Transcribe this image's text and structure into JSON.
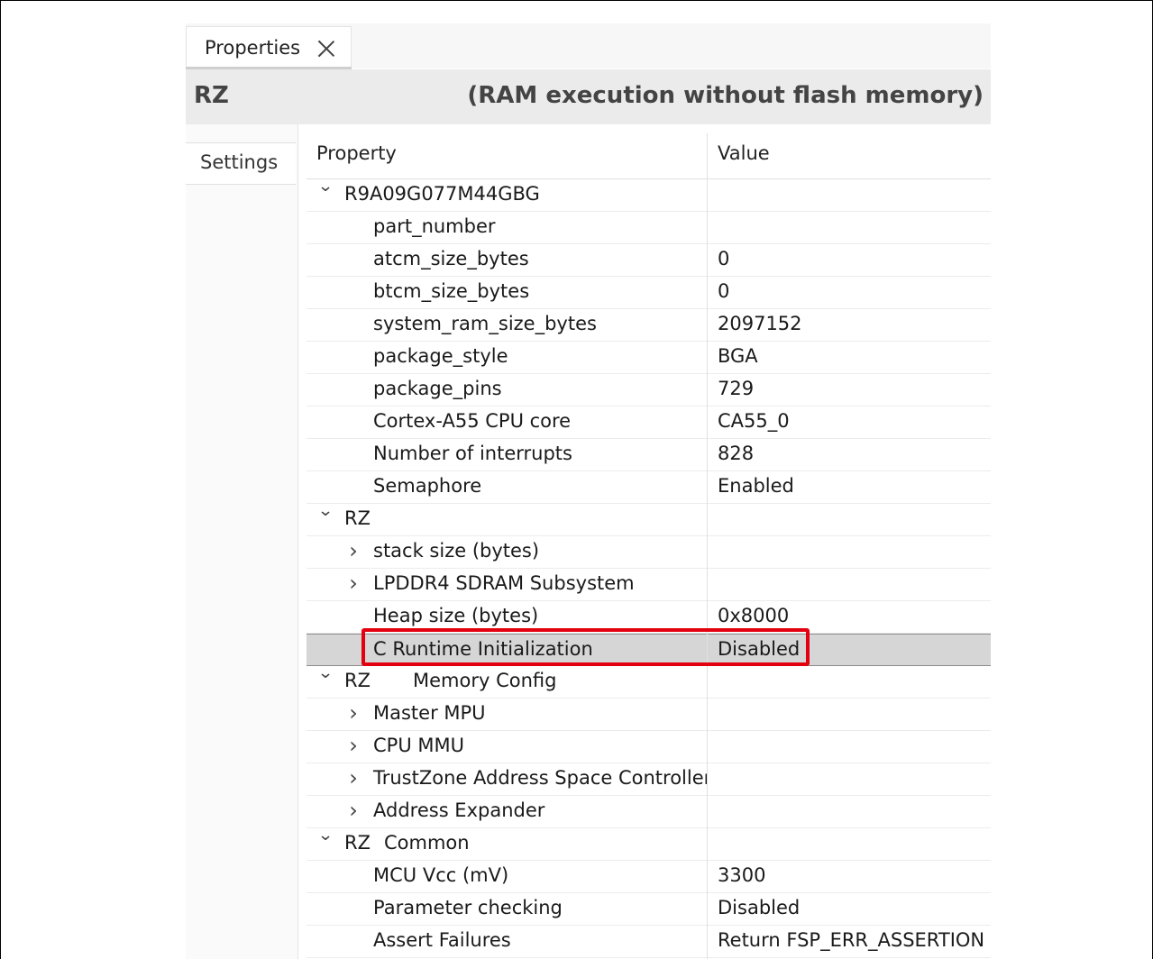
{
  "tab": {
    "label": "Properties",
    "close_icon": "close-icon"
  },
  "header": {
    "left": "RZ",
    "right": "(RAM execution without flash memory)"
  },
  "sidebar": {
    "tab_label": "Settings"
  },
  "table": {
    "col_property": "Property",
    "col_value": "Value",
    "rows": [
      {
        "prop": "R9A09G077M44GBG",
        "val": "",
        "level": 0,
        "twisty": "down"
      },
      {
        "prop": "part_number",
        "val": "",
        "level": 2,
        "twisty": ""
      },
      {
        "prop": "atcm_size_bytes",
        "val": "0",
        "level": 2,
        "twisty": ""
      },
      {
        "prop": "btcm_size_bytes",
        "val": "0",
        "level": 2,
        "twisty": ""
      },
      {
        "prop": "system_ram_size_bytes",
        "val": "2097152",
        "level": 2,
        "twisty": ""
      },
      {
        "prop": "package_style",
        "val": "BGA",
        "level": 2,
        "twisty": ""
      },
      {
        "prop": "package_pins",
        "val": "729",
        "level": 2,
        "twisty": ""
      },
      {
        "prop": "Cortex-A55 CPU core",
        "val": "CA55_0",
        "level": 2,
        "twisty": ""
      },
      {
        "prop": "Number of interrupts",
        "val": "828",
        "level": 2,
        "twisty": ""
      },
      {
        "prop": "Semaphore",
        "val": "Enabled",
        "level": 2,
        "twisty": ""
      },
      {
        "prop": "RZ",
        "val": "",
        "level": 0,
        "twisty": "down"
      },
      {
        "prop": "stack size (bytes)",
        "val": "",
        "level": 1,
        "twisty": "right"
      },
      {
        "prop": "LPDDR4 SDRAM Subsystem",
        "val": "",
        "level": 1,
        "twisty": "right"
      },
      {
        "prop": "Heap size (bytes)",
        "val": "0x8000",
        "level": 2,
        "twisty": ""
      },
      {
        "prop": "C Runtime Initialization",
        "val": "Disabled",
        "level": 2,
        "twisty": "",
        "selected": true
      },
      {
        "prop": "RZ",
        "suffix": "Memory Config",
        "val": "",
        "level": 0,
        "twisty": "down",
        "gap": 48
      },
      {
        "prop": "Master MPU",
        "val": "",
        "level": 1,
        "twisty": "right"
      },
      {
        "prop": "CPU MMU",
        "val": "",
        "level": 1,
        "twisty": "right"
      },
      {
        "prop": "TrustZone Address Space Controller",
        "val": "",
        "level": 1,
        "twisty": "right"
      },
      {
        "prop": "Address Expander",
        "val": "",
        "level": 1,
        "twisty": "right"
      },
      {
        "prop": "RZ",
        "suffix": "Common",
        "val": "",
        "level": 0,
        "twisty": "down",
        "gap": 16
      },
      {
        "prop": "MCU Vcc (mV)",
        "val": "3300",
        "level": 2,
        "twisty": ""
      },
      {
        "prop": "Parameter checking",
        "val": "Disabled",
        "level": 2,
        "twisty": ""
      },
      {
        "prop": "Assert Failures",
        "val": "Return FSP_ERR_ASSERTION",
        "level": 2,
        "twisty": ""
      }
    ]
  },
  "colors": {
    "highlight": "#e3000f",
    "selected_row": "#d6d6d6"
  }
}
